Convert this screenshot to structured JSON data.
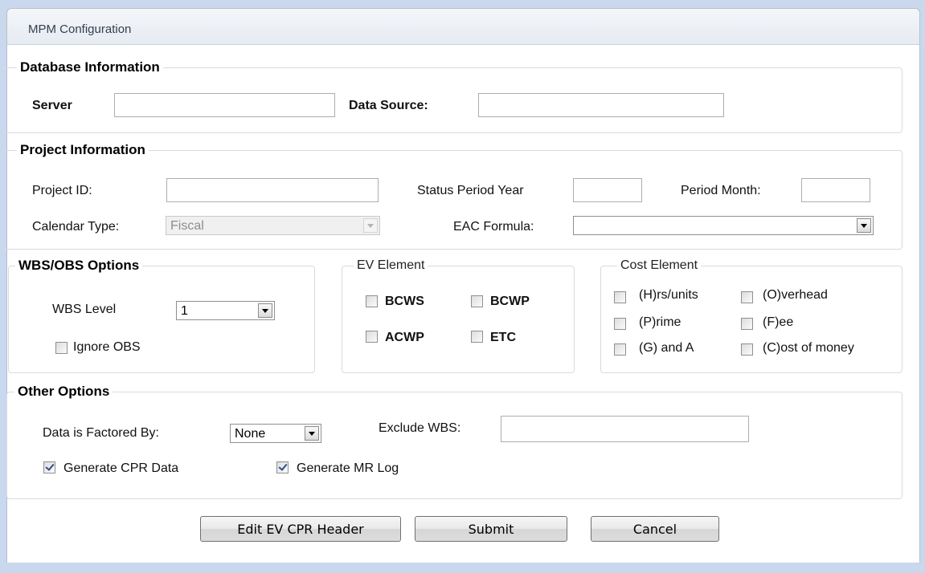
{
  "window": {
    "title": "MPM Configuration"
  },
  "database": {
    "legend": "Database Information",
    "server_label": "Server",
    "server_value": "",
    "datasource_label": "Data Source:",
    "datasource_value": ""
  },
  "project": {
    "legend": "Project Information",
    "project_id_label": "Project ID:",
    "project_id_value": "",
    "status_year_label": "Status Period Year",
    "status_year_value": "",
    "period_month_label": "Period Month:",
    "period_month_value": "",
    "calendar_type_label": "Calendar Type:",
    "calendar_type_value": "Fiscal",
    "eac_formula_label": "EAC Formula:",
    "eac_formula_value": ""
  },
  "wbs": {
    "legend": "WBS/OBS Options",
    "wbs_level_label": "WBS Level",
    "wbs_level_value": "1",
    "ignore_obs_label": "Ignore OBS",
    "ignore_obs_checked": false
  },
  "ev": {
    "legend": "EV Element",
    "items": [
      {
        "label": "BCWS",
        "checked": false
      },
      {
        "label": "BCWP",
        "checked": false
      },
      {
        "label": "ACWP",
        "checked": false
      },
      {
        "label": "ETC",
        "checked": false
      }
    ]
  },
  "cost": {
    "legend": "Cost Element",
    "items": [
      {
        "label": "(H)rs/units",
        "checked": false
      },
      {
        "label": "(O)verhead",
        "checked": false
      },
      {
        "label": "(P)rime",
        "checked": false
      },
      {
        "label": "(F)ee",
        "checked": false
      },
      {
        "label": "(G) and A",
        "checked": false
      },
      {
        "label": "(C)ost of money",
        "checked": false
      }
    ]
  },
  "other": {
    "legend": "Other Options",
    "factored_label": "Data is Factored By:",
    "factored_value": "None",
    "exclude_wbs_label": "Exclude WBS:",
    "exclude_wbs_value": "",
    "gen_cpr_label": "Generate CPR Data",
    "gen_cpr_checked": true,
    "gen_mr_label": "Generate MR Log",
    "gen_mr_checked": true
  },
  "buttons": {
    "edit_header": "Edit EV CPR Header",
    "submit": "Submit",
    "cancel": "Cancel"
  }
}
